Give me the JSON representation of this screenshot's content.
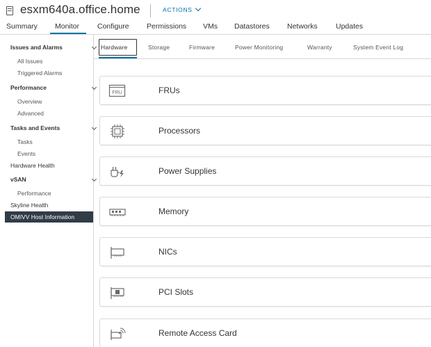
{
  "header": {
    "title": "esxm640a.office.home",
    "actions_label": "ACTIONS"
  },
  "top_tabs": [
    {
      "label": "Summary"
    },
    {
      "label": "Monitor",
      "active": true
    },
    {
      "label": "Configure"
    },
    {
      "label": "Permissions"
    },
    {
      "label": "VMs"
    },
    {
      "label": "Datastores"
    },
    {
      "label": "Networks"
    },
    {
      "label": "Updates"
    }
  ],
  "sidebar": {
    "items": [
      {
        "label": "Issues and Alarms",
        "type": "section",
        "expanded": true
      },
      {
        "label": "All Issues",
        "type": "child"
      },
      {
        "label": "Triggered Alarms",
        "type": "child"
      },
      {
        "label": "Performance",
        "type": "section",
        "expanded": true
      },
      {
        "label": "Overview",
        "type": "child"
      },
      {
        "label": "Advanced",
        "type": "child"
      },
      {
        "label": "Tasks and Events",
        "type": "section",
        "expanded": true
      },
      {
        "label": "Tasks",
        "type": "child"
      },
      {
        "label": "Events",
        "type": "child"
      },
      {
        "label": "Hardware Health",
        "type": "plain"
      },
      {
        "label": "vSAN",
        "type": "section",
        "expanded": true
      },
      {
        "label": "Performance",
        "type": "child"
      },
      {
        "label": "Skyline Health",
        "type": "plain"
      },
      {
        "label": "OMIVV Host Information",
        "type": "plain",
        "selected": true
      }
    ]
  },
  "sub_tabs": [
    {
      "label": "Hardware",
      "active": true
    },
    {
      "label": "Storage"
    },
    {
      "label": "Firmware"
    },
    {
      "label": "Power Monitoring"
    },
    {
      "label": "Warranty"
    },
    {
      "label": "System Event Log"
    }
  ],
  "cards": [
    {
      "label": "FRUs",
      "icon": "fru-icon",
      "icon_text": "FRU"
    },
    {
      "label": "Processors",
      "icon": "processor-icon"
    },
    {
      "label": "Power Supplies",
      "icon": "power-plug-icon"
    },
    {
      "label": "Memory",
      "icon": "memory-icon"
    },
    {
      "label": "NICs",
      "icon": "nic-icon"
    },
    {
      "label": "PCI Slots",
      "icon": "pci-slot-icon"
    },
    {
      "label": "Remote Access Card",
      "icon": "remote-access-card-icon"
    }
  ],
  "colors": {
    "accent": "#0072a3",
    "selected_bg": "#313c47",
    "border": "#d6d6d6"
  }
}
